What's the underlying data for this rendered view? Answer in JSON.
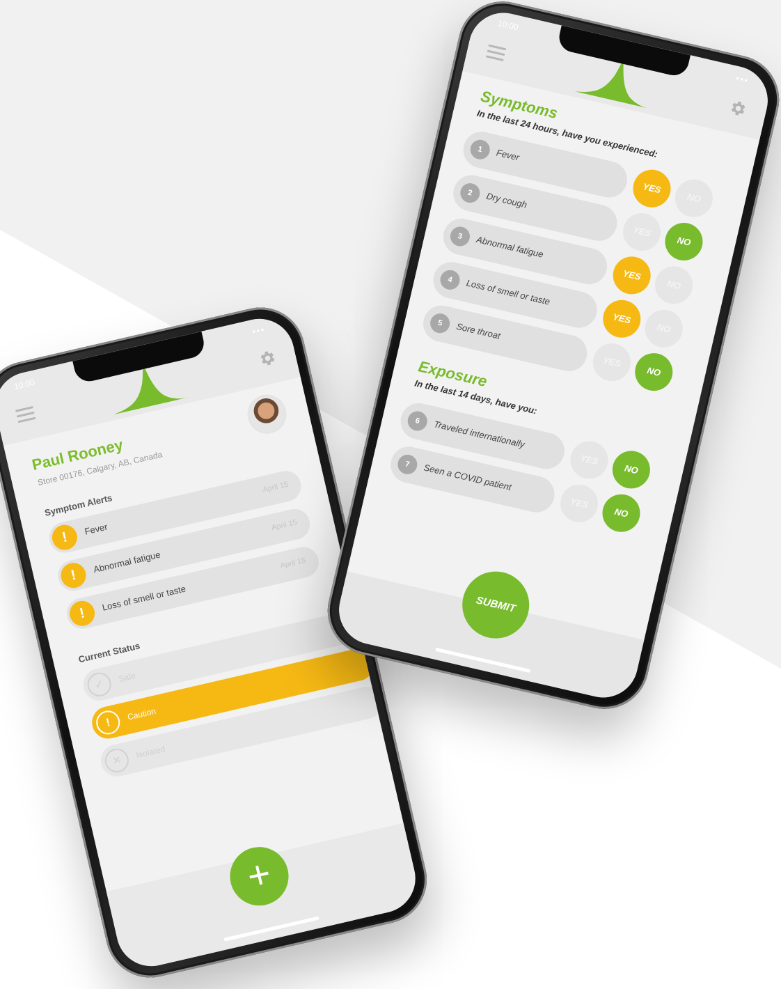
{
  "colors": {
    "brand_green": "#78bb2c",
    "caution_yellow": "#f6b914",
    "background_gray": "#f2f2f2"
  },
  "left_phone": {
    "status_time": "10:00",
    "icons": {
      "menu": "menu-icon",
      "settings": "gear-icon",
      "logo": "logo-icon"
    },
    "user": {
      "name": "Paul Rooney",
      "store": "Store 00176, Calgary, AB, Canada"
    },
    "symptom_alerts": {
      "title": "Symptom Alerts",
      "items": [
        {
          "label": "Fever",
          "date": "April 15"
        },
        {
          "label": "Abnormal fatigue",
          "date": "April 15"
        },
        {
          "label": "Loss of smell or taste",
          "date": "April 15"
        }
      ]
    },
    "current_status": {
      "title": "Current Status",
      "options": [
        {
          "label": "Safe",
          "icon": "checkmark-icon",
          "selected": false
        },
        {
          "label": "Caution",
          "icon": "exclamation-icon",
          "selected": true
        },
        {
          "label": "Isolated",
          "icon": "x-icon",
          "selected": false
        }
      ]
    },
    "add_button": "+"
  },
  "right_phone": {
    "status_time": "10:00",
    "icons": {
      "menu": "menu-icon",
      "settings": "gear-icon",
      "logo": "logo-icon"
    },
    "symptoms": {
      "title": "Symptoms",
      "subtitle": "In the last 24 hours, have you experienced:",
      "questions": [
        {
          "num": "1",
          "label": "Fever",
          "answer": "YES"
        },
        {
          "num": "2",
          "label": "Dry cough",
          "answer": "NO"
        },
        {
          "num": "3",
          "label": "Abnormal fatigue",
          "answer": "YES"
        },
        {
          "num": "4",
          "label": "Loss of smell or taste",
          "answer": "YES"
        },
        {
          "num": "5",
          "label": "Sore throat",
          "answer": "NO"
        }
      ]
    },
    "exposure": {
      "title": "Exposure",
      "subtitle": "In the last 14 days, have you:",
      "questions": [
        {
          "num": "6",
          "label": "Traveled internationally",
          "answer": "NO"
        },
        {
          "num": "7",
          "label": "Seen a COVID patient",
          "answer": "NO"
        }
      ]
    },
    "yes_label": "YES",
    "no_label": "NO",
    "submit_label": "SUBMIT"
  }
}
